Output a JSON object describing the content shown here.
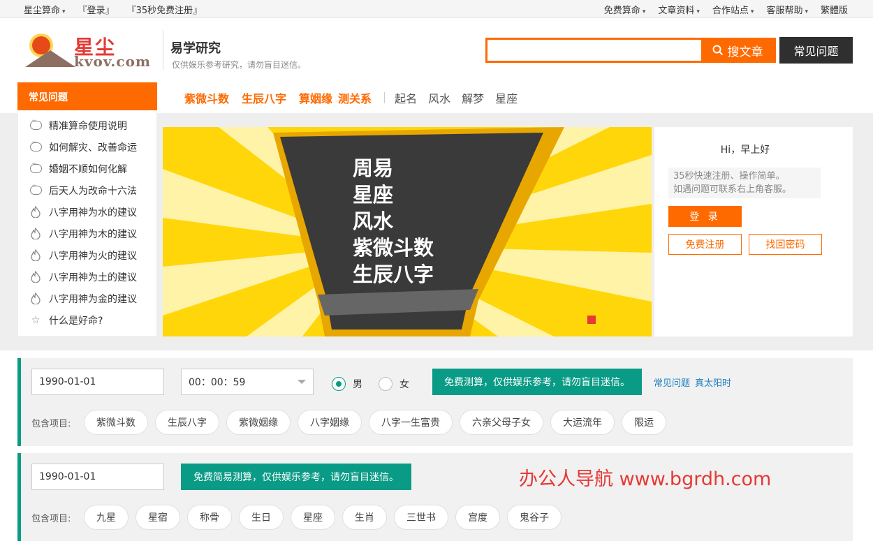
{
  "topbar": {
    "left": [
      {
        "label": "星尘算命",
        "has_caret": true
      },
      {
        "label": "『登录』",
        "has_caret": false
      },
      {
        "label": "『35秒免费注册』",
        "has_caret": false
      }
    ],
    "right": [
      {
        "label": "免费算命",
        "has_caret": true
      },
      {
        "label": "文章资料",
        "has_caret": true
      },
      {
        "label": "合作站点",
        "has_caret": true
      },
      {
        "label": "客服帮助",
        "has_caret": true
      },
      {
        "label": "繁體版",
        "has_caret": false
      }
    ]
  },
  "header": {
    "logo_cn": "星尘",
    "logo_en": "kvov.com",
    "title": "易学研究",
    "subtitle": "仅供娱乐参考研究，请勿盲目迷信。",
    "search_placeholder": "",
    "search_button": "搜文章",
    "faq_button": "常见问题"
  },
  "nav": {
    "hot": [
      "紫微斗数",
      "生辰八字",
      "算姻缘",
      "测关系"
    ],
    "normal": [
      "起名",
      "风水",
      "解梦",
      "星座"
    ]
  },
  "sidebar": {
    "title": "常见问题",
    "items": [
      {
        "label": "精准算命使用说明",
        "icon": "chat-bubble-icon"
      },
      {
        "label": "如何解灾、改善命运",
        "icon": "chat-bubble-icon"
      },
      {
        "label": "婚姻不顺如何化解",
        "icon": "chat-bubble-icon"
      },
      {
        "label": "后天人为改命十六法",
        "icon": "chat-bubble-icon"
      },
      {
        "label": "八字用神为水的建议",
        "icon": "flame-icon"
      },
      {
        "label": "八字用神为木的建议",
        "icon": "flame-icon"
      },
      {
        "label": "八字用神为火的建议",
        "icon": "flame-icon"
      },
      {
        "label": "八字用神为土的建议",
        "icon": "flame-icon"
      },
      {
        "label": "八字用神为金的建议",
        "icon": "flame-icon"
      },
      {
        "label": "什么是好命?",
        "icon": "star-icon"
      }
    ]
  },
  "banner": {
    "lines": [
      "周易",
      "星座",
      "风水",
      "紫微斗数",
      "生辰八字"
    ],
    "colors": {
      "bg": "#ffd60a",
      "ray": "#fff3a8",
      "shape": "#3a3a3a",
      "border": "#e8a600"
    }
  },
  "login": {
    "greeting": "Hi，早上好",
    "tip_line1": "35秒快速注册、操作简单。",
    "tip_line2": "如遇问题可联系右上角客服。",
    "login_button": "登 录",
    "register_button": "免费注册",
    "recover_button": "找回密码"
  },
  "form1": {
    "date": "1990-01-01",
    "time": "00：00：59",
    "gender_male": "男",
    "gender_female": "女",
    "gender_selected": "male",
    "submit": "免费测算，仅供娱乐参考，请勿盲目迷信。",
    "link_faq": "常见问题",
    "link_solar": "真太阳时",
    "include_label": "包含项目:",
    "tags": [
      "紫微斗数",
      "生辰八字",
      "紫微姻缘",
      "八字姻缘",
      "八字一生富贵",
      "六亲父母子女",
      "大运流年",
      "限运"
    ]
  },
  "form2": {
    "date": "1990-01-01",
    "submit": "免费简易测算，仅供娱乐参考，请勿盲目迷信。",
    "include_label": "包含项目:",
    "tags": [
      "九星",
      "星宿",
      "称骨",
      "生日",
      "星座",
      "生肖",
      "三世书",
      "宫度",
      "鬼谷子"
    ]
  },
  "watermark": "办公人导航 www.bgrdh.com",
  "colors": {
    "accent": "#ff6a00",
    "teal": "#0a9b86",
    "dark": "#2f2f2f",
    "link": "#1a7fc1"
  }
}
